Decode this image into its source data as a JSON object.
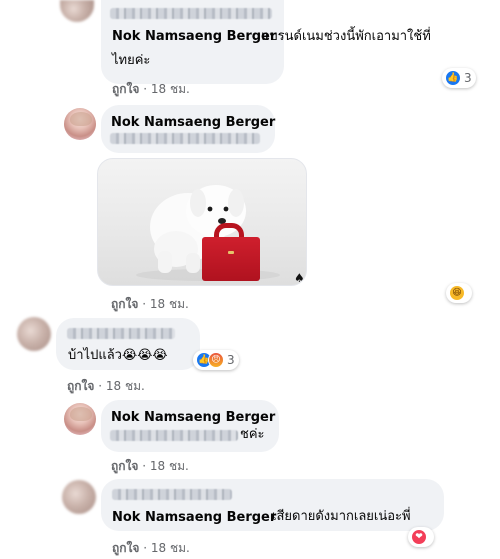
{
  "comments": [
    {
      "id": "c1",
      "author": "Nok Namsaeng Berger",
      "text_line1": "แบรนด์เนมช่วงนี้พักเอามาใช้ที่",
      "text_line2": "ไทยค่ะ",
      "reaction_count": "3",
      "like_label": "ถูกใจ",
      "time": "18 ชม."
    },
    {
      "id": "c2",
      "author": "Nok Namsaeng Berger",
      "like_label": "ถูกใจ",
      "time": "18 ชม.",
      "photo_alt": "white puppy with red handbag"
    },
    {
      "id": "c3",
      "text": "บ้าไปแล้ว",
      "emoji": "😭😭😭",
      "reaction_count": "3",
      "like_label": "ถูกใจ",
      "time": "18 ชม."
    },
    {
      "id": "c4",
      "author": "Nok Namsaeng Berger",
      "text_suffix": "ชค่ะ",
      "like_label": "ถูกใจ",
      "time": "18 ชม."
    },
    {
      "id": "c5",
      "author": "Nok Namsaeng Berger",
      "text": "เสียดายดังมากเลยเน่อะพี่",
      "like_label": "ถูกใจ",
      "time": "18 ชม."
    }
  ],
  "icons": {
    "like": "like-reaction-icon",
    "angry": "angry-reaction-icon",
    "haha": "haha-reaction-icon",
    "love": "love-reaction-icon"
  },
  "colors": {
    "bubble": "#f0f2f5",
    "meta_text": "#65676b",
    "like_blue": "#1877f2",
    "love_red": "#f33e58"
  }
}
